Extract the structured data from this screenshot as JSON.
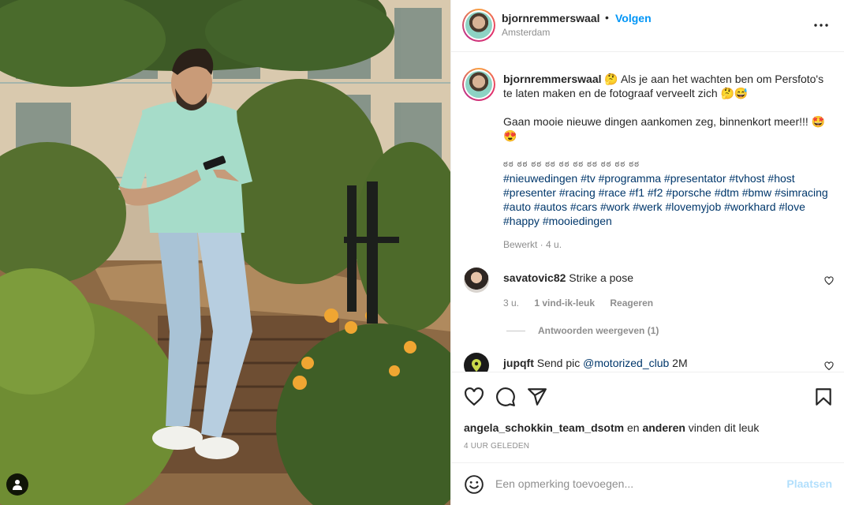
{
  "header": {
    "username": "bjornremmerswaal",
    "separator": "•",
    "follow_label": "Volgen",
    "location": "Amsterdam",
    "more_icon": "more-horizontal-icon"
  },
  "caption": {
    "username": "bjornremmerswaal",
    "line1": "🤔 Als je aan het wachten ben om Persfoto's te laten maken en de fotograaf verveelt zich 🤔😅",
    "line2": "Gaan mooie nieuwe dingen aankomen zeg, binnenkort meer!!! 🤩😍",
    "dots": "ಠಠ ಠಠ ಠಠ ಠಠ ಠಠ ಠಠ ಠಠ ಠಠ ಠಠ ಠಠ",
    "hashtags": "#nieuwedingen #tv #programma #presentator #tvhost #host #presenter #racing #race #f1 #f2 #porsche #dtm #bmw #simracing #auto #autos #cars #work #werk #lovemyjob #workhard #love #happy #mooiedingen",
    "edited": "Bewerkt · 4 u."
  },
  "comments": [
    {
      "username": "savatovic82",
      "text": "Strike a pose",
      "time": "3 u.",
      "likes": "1 vind-ik-leuk",
      "reply_label": "Reageren",
      "view_replies": "Antwoorden weergeven (1)"
    },
    {
      "username": "jupqft",
      "text_before": "Send pic ",
      "mention": "@motorized_club",
      "text_after": " 2M"
    }
  ],
  "actions": {
    "liked_by": "angela_schokkin_team_dsotm",
    "liked_mid": " en ",
    "liked_others": "anderen",
    "liked_tail": " vinden dit leuk",
    "age": "4 uur geleden"
  },
  "add_comment": {
    "placeholder": "Een opmerking toevoegen...",
    "post_label": "Plaatsen"
  },
  "colors": {
    "accent": "#0095f6",
    "link": "#00376b",
    "muted": "#8e8e8e",
    "post_disabled": "#b2dffc"
  },
  "icons": [
    "heart-icon",
    "comment-icon",
    "share-icon",
    "bookmark-icon",
    "emoji-icon",
    "user-tag-icon"
  ]
}
